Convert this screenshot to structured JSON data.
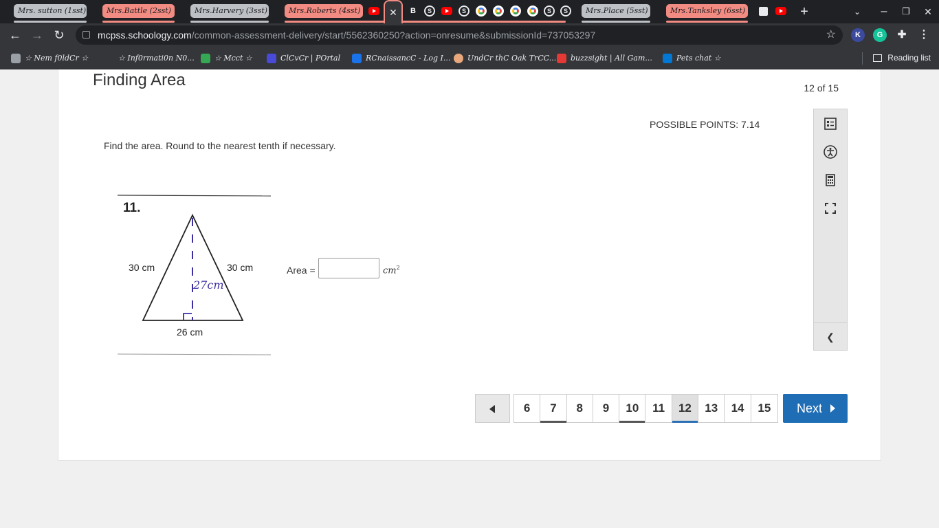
{
  "browser": {
    "tab_groups": [
      {
        "label": "Mrs. sutton (1sst)",
        "color": "grey"
      },
      {
        "label": "Mrs.Battle (2sst)",
        "color": "red"
      },
      {
        "label": "Mrs.Harvery (3sst)",
        "color": "grey"
      },
      {
        "label": "Mrs.Roberts (4sst)",
        "color": "red"
      },
      {
        "label": "Mrs.Place (5sst)",
        "color": "grey"
      },
      {
        "label": "Mrs.Tanksley (6sst)",
        "color": "red"
      }
    ],
    "active_tab_close": "✕",
    "new_tab": "+",
    "url_host": "mcpss.schoology.com",
    "url_path": "/common-assessment-delivery/start/5562360250?action=onresume&submissionId=737053297",
    "bookmarks": [
      "☆ Nem f0ldCr ☆",
      "☆ Inf0rmati0n N0...",
      "☆ Mcct ☆",
      "ClCvCr | POrtal",
      "RCnaissancC - Log I...",
      "UndCr thC Oak TrCC...",
      "buzzsight | All Gam...",
      "Pets chat ☆"
    ],
    "reading_list": "Reading list",
    "extensions": [
      "K",
      "G"
    ]
  },
  "assessment": {
    "title": "Finding Area",
    "counter": "12 of 15",
    "possible_points": "POSSIBLE POINTS: 7.14",
    "prompt": "Find the area. Round to the nearest tenth if necessary.",
    "figure": {
      "number": "11.",
      "left_side": "30 cm",
      "right_side": "30 cm",
      "base": "26 cm",
      "height_note": "27cm"
    },
    "answer_label": "Area =",
    "answer_value": "",
    "unit": "cm",
    "unit_exp": "2"
  },
  "pager": {
    "pages": [
      {
        "n": "6",
        "state": "plain"
      },
      {
        "n": "7",
        "state": "answered"
      },
      {
        "n": "8",
        "state": "plain"
      },
      {
        "n": "9",
        "state": "plain"
      },
      {
        "n": "10",
        "state": "answered"
      },
      {
        "n": "11",
        "state": "plain"
      },
      {
        "n": "12",
        "state": "current"
      },
      {
        "n": "13",
        "state": "plain"
      },
      {
        "n": "14",
        "state": "plain"
      },
      {
        "n": "15",
        "state": "plain"
      }
    ],
    "next_label": "Next"
  },
  "colors": {
    "accent": "#1e6db5",
    "tab_red": "#f28b82",
    "tab_grey": "#bdc1c6"
  }
}
